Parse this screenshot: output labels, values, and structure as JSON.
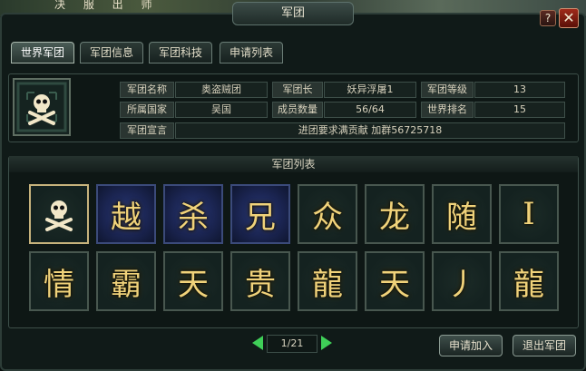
{
  "background": {
    "scene_text": "决 服 出 师"
  },
  "window": {
    "title": "军团"
  },
  "controls": {
    "help": "?",
    "close": "✕"
  },
  "tabs": [
    {
      "label": "世界军团",
      "active": true
    },
    {
      "label": "军团信息",
      "active": false
    },
    {
      "label": "军团科技",
      "active": false
    },
    {
      "label": "申请列表",
      "active": false
    }
  ],
  "legion": {
    "emblem": "skull-crossbones-icon",
    "name_label": "军团名称",
    "name": "奥盗贼团",
    "leader_label": "军团长",
    "leader": "妖异浮屠1",
    "level_label": "军团等级",
    "level": "13",
    "country_label": "所属国家",
    "country": "吴国",
    "members_label": "成员数量",
    "members": "56/64",
    "rank_label": "世界排名",
    "rank": "15",
    "motto_label": "军团宣言",
    "motto": "进团要求满贡献 加群56725718"
  },
  "list": {
    "header": "军团列表",
    "row1": [
      {
        "char": "",
        "icon": "skull-crossbones-icon",
        "style": "green",
        "selected": true
      },
      {
        "char": "越",
        "style": "blue"
      },
      {
        "char": "杀",
        "style": "blue"
      },
      {
        "char": "兄",
        "style": "blue"
      },
      {
        "char": "众",
        "style": "green"
      },
      {
        "char": "龙",
        "style": "green"
      },
      {
        "char": "随",
        "style": "green"
      },
      {
        "char": "I",
        "style": "green"
      }
    ],
    "row2": [
      {
        "char": "情",
        "style": "green"
      },
      {
        "char": "霸",
        "style": "green"
      },
      {
        "char": "天",
        "style": "green"
      },
      {
        "char": "贵",
        "style": "green"
      },
      {
        "char": "龍",
        "style": "green"
      },
      {
        "char": "天",
        "style": "green"
      },
      {
        "char": "丿",
        "style": "green"
      },
      {
        "char": "龍",
        "style": "green"
      }
    ]
  },
  "pager": {
    "page": "1/21"
  },
  "buttons": {
    "apply": "申请加入",
    "quit": "退出军团"
  },
  "colors": {
    "accent_gold": "#f0d27a",
    "arrow_green": "#3fcf58",
    "frame": "#3d4f49"
  }
}
